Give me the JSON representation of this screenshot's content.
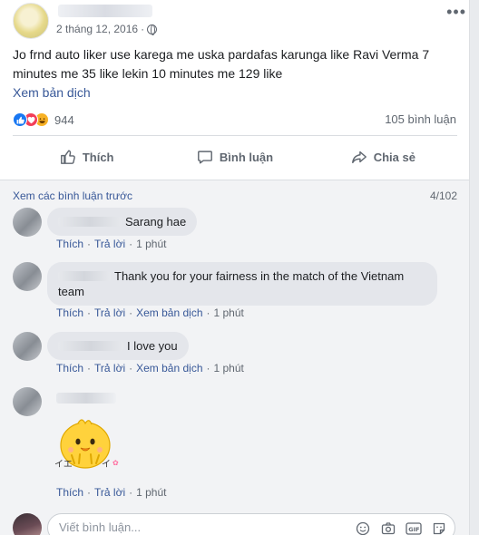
{
  "post": {
    "timestamp": "2 tháng 12, 2016",
    "text": "Jo frnd auto liker use karega me uska pardafas karunga like Ravi Verma 7 minutes me 35 like lekin 10 minutes me 129 like",
    "see_translation": "Xem bản dịch",
    "reaction_count": "944",
    "comment_count": "105 bình luận",
    "reactions": [
      "like-icon",
      "love-icon",
      "haha-icon"
    ]
  },
  "actions": {
    "like": "Thích",
    "comment": "Bình luận",
    "share": "Chia sẻ"
  },
  "comments_section": {
    "prev_link": "Xem các bình luận trước",
    "pager": "4/102",
    "items": [
      {
        "text": "Sarang hae",
        "like": "Thích",
        "reply": "Trả lời",
        "time": "1 phút"
      },
      {
        "text": "Thank you for your fairness in the match of the Vietnam team",
        "like": "Thích",
        "reply": "Trả lời",
        "translate": "Xem bản dịch",
        "time": "1 phút"
      },
      {
        "text": "I love you",
        "like": "Thích",
        "reply": "Trả lời",
        "translate": "Xem bản dịch",
        "time": "1 phút"
      },
      {
        "sticker": "chick-sticker",
        "sticker_text": "イエ~イ",
        "like": "Thích",
        "reply": "Trả lời",
        "time": "1 phút"
      }
    ]
  },
  "composer": {
    "placeholder": "Viết bình luận...",
    "icons": [
      "emoji-icon",
      "camera-icon",
      "gif-icon",
      "sticker-icon"
    ]
  },
  "colors": {
    "link": "#385898",
    "like_blue": "#1877f2",
    "love_red": "#f33e58",
    "haha_yellow": "#f7b125",
    "comment_bg": "#f2f3f5"
  }
}
